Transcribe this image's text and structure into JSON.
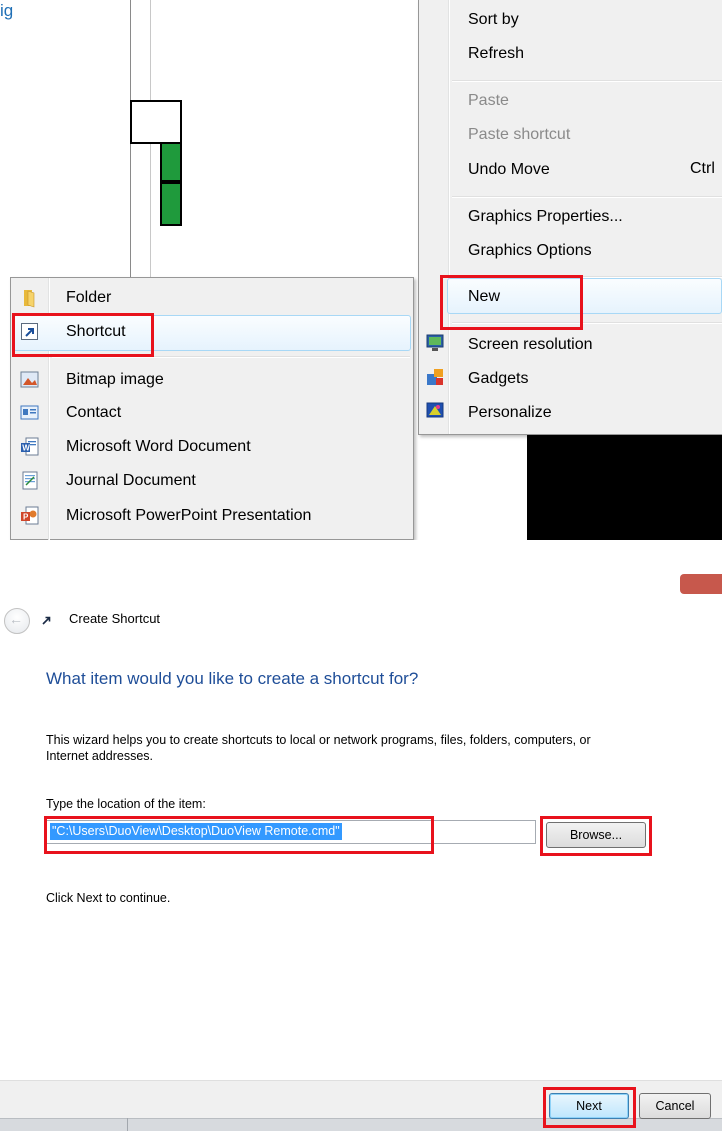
{
  "top_crop_text": "ig",
  "context_menu": {
    "items": {
      "sort_by": "Sort by",
      "refresh": "Refresh",
      "paste": "Paste",
      "paste_shortcut": "Paste shortcut",
      "undo_move": "Undo Move",
      "undo_shortcut": "Ctrl",
      "graphics_properties": "Graphics Properties...",
      "graphics_options": "Graphics Options",
      "new": "New",
      "screen_resolution": "Screen resolution",
      "gadgets": "Gadgets",
      "personalize": "Personalize"
    },
    "icons": {
      "screen_resolution": "monitor-icon",
      "gadgets": "gadgets-icon",
      "personalize": "personalize-icon"
    }
  },
  "new_submenu": {
    "items": [
      {
        "label": "Folder",
        "icon": "folder-icon"
      },
      {
        "label": "Shortcut",
        "icon": "shortcut-icon"
      },
      {
        "label": "Bitmap image",
        "icon": "bitmap-icon"
      },
      {
        "label": "Contact",
        "icon": "contact-icon"
      },
      {
        "label": "Microsoft Word Document",
        "icon": "word-icon"
      },
      {
        "label": "Journal Document",
        "icon": "journal-icon"
      },
      {
        "label": "Microsoft PowerPoint Presentation",
        "icon": "powerpoint-icon"
      }
    ]
  },
  "dialog": {
    "title": "Create Shortcut",
    "heading": "What item would you like to create a shortcut for?",
    "description_line1": "This wizard helps you to create shortcuts to local or network programs, files, folders, computers, or",
    "description_line2": "Internet addresses.",
    "field_label": "Type the location of the item:",
    "location_value": "\"C:\\Users\\DuoView\\Desktop\\DuoView Remote.cmd\"",
    "browse_label": "Browse...",
    "continue_text": "Click Next to continue.",
    "next_label": "Next",
    "cancel_label": "Cancel"
  },
  "colors": {
    "highlight_red": "#e8121c",
    "heading_blue": "#1f4e98",
    "selection_blue": "#3399ff"
  }
}
